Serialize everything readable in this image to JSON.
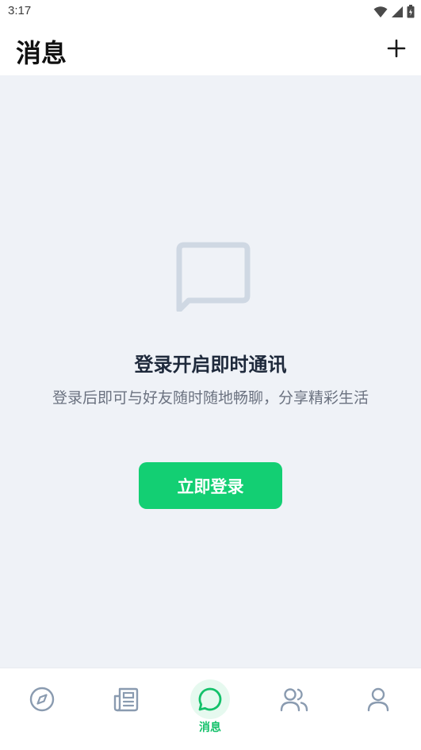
{
  "status_bar": {
    "time": "3:17"
  },
  "header": {
    "title": "消息",
    "add_icon": "plus-icon"
  },
  "empty_state": {
    "icon": "chat-bubble-icon",
    "title": "登录开启即时通讯",
    "description": "登录后即可与好友随时随地畅聊，分享精彩生活",
    "button_label": "立即登录"
  },
  "bottom_nav": {
    "items": [
      {
        "icon": "compass-icon",
        "label": ""
      },
      {
        "icon": "news-icon",
        "label": ""
      },
      {
        "icon": "message-icon",
        "label": "消息",
        "active": true
      },
      {
        "icon": "contacts-icon",
        "label": ""
      },
      {
        "icon": "profile-icon",
        "label": ""
      }
    ]
  },
  "colors": {
    "accent": "#13cf73",
    "background": "#eff2f7",
    "nav_inactive": "#8a9bb0"
  }
}
